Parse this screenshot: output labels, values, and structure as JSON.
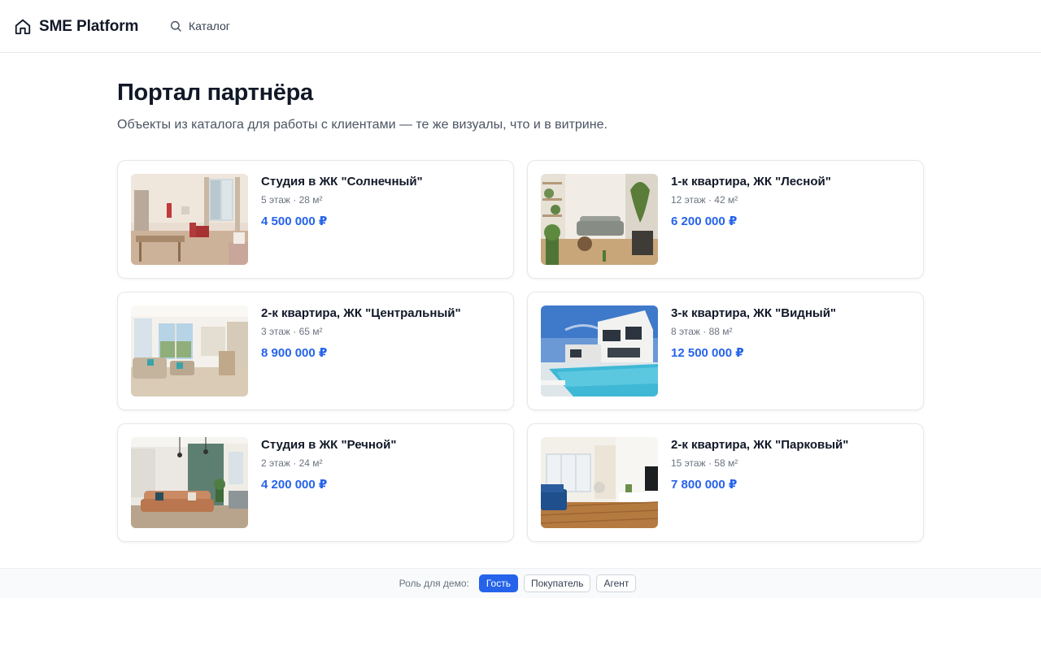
{
  "header": {
    "brand": "SME Platform",
    "nav_catalog": "Каталог"
  },
  "main": {
    "title": "Портал партнёра",
    "subtitle": "Объекты из каталога для работы с клиентами — те же визуалы, что и в витрине."
  },
  "listings": [
    {
      "title": "Студия в ЖК \"Солнечный\"",
      "meta": "5 этаж · 28 м²",
      "price": "4 500 000 ₽"
    },
    {
      "title": "1-к квартира, ЖК \"Лесной\"",
      "meta": "12 этаж · 42 м²",
      "price": "6 200 000 ₽"
    },
    {
      "title": "2-к квартира, ЖК \"Центральный\"",
      "meta": "3 этаж · 65 м²",
      "price": "8 900 000 ₽"
    },
    {
      "title": "3-к квартира, ЖК \"Видный\"",
      "meta": "8 этаж · 88 м²",
      "price": "12 500 000 ₽"
    },
    {
      "title": "Студия в ЖК \"Речной\"",
      "meta": "2 этаж · 24 м²",
      "price": "4 200 000 ₽"
    },
    {
      "title": "2-к квартира, ЖК \"Парковый\"",
      "meta": "15 этаж · 58 м²",
      "price": "7 800 000 ₽"
    }
  ],
  "role_bar": {
    "label": "Роль для демо:",
    "roles": [
      "Гость",
      "Покупатель",
      "Агент"
    ],
    "active": "Гость"
  },
  "colors": {
    "accent": "#2563eb",
    "text": "#111827",
    "muted": "#6b7280",
    "border": "#e5e7eb"
  },
  "icons": {
    "brand": "home-icon",
    "catalog": "search-icon"
  }
}
